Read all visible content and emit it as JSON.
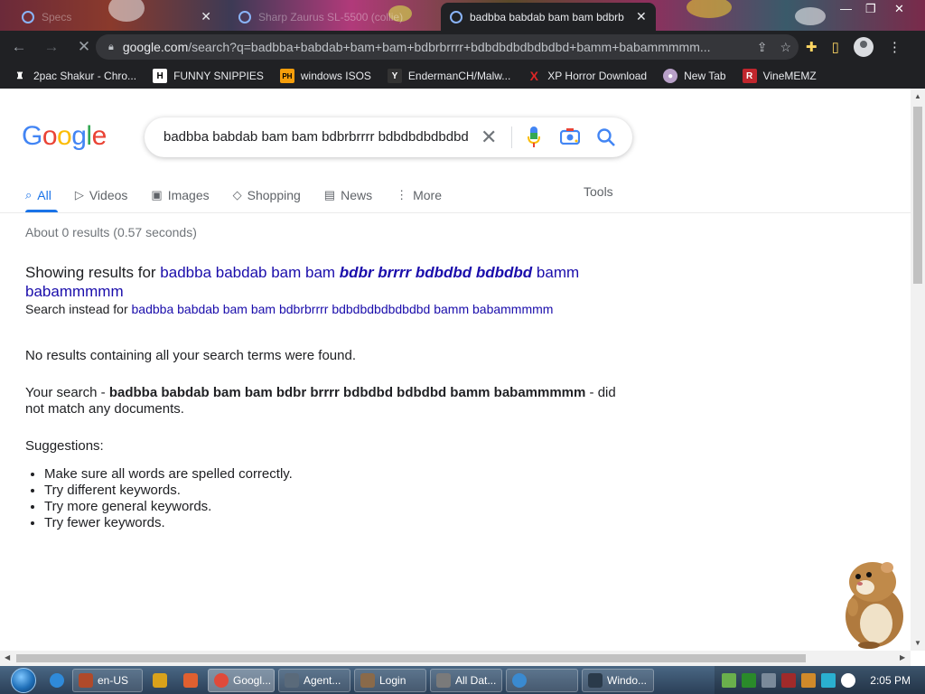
{
  "browser": {
    "tabs": [
      {
        "title": "Specs"
      },
      {
        "title": "Sharp Zaurus SL-5500 (collie)"
      },
      {
        "title": "badbba babdab bam bam bdbrb"
      }
    ],
    "url_host": "google.com",
    "url_path": "/search?q=badbba+babdab+bam+bam+bdbrbrrrr+bdbdbdbdbdbdbd+bamm+babammmmm...",
    "bookmarks": [
      {
        "label": "2pac Shakur - Chro...",
        "color": "#7a5230",
        "glyph": "♜"
      },
      {
        "label": "FUNNY SNIPPIES",
        "color": "#000000",
        "glyph": "H"
      },
      {
        "label": "windows ISOS",
        "color": "#f59e0b",
        "glyph": "PH"
      },
      {
        "label": "EndermanCH/Malw...",
        "color": "#111111",
        "glyph": "Y"
      },
      {
        "label": "XP Horror Download",
        "color": "#dc2626",
        "glyph": "X"
      },
      {
        "label": "New Tab",
        "color": "#a0a0c0",
        "glyph": "●"
      },
      {
        "label": "VineMEMZ",
        "color": "#c0262d",
        "glyph": "R"
      }
    ]
  },
  "google": {
    "logo": "Google",
    "query": "badbba babdab bam bam bdbrbrrrr bdbdbdbdbdbdbd",
    "tabs": [
      {
        "label": "All",
        "icon": "search-icon",
        "glyph": "⌕"
      },
      {
        "label": "Videos",
        "icon": "video-icon",
        "glyph": "▷"
      },
      {
        "label": "Images",
        "icon": "image-icon",
        "glyph": "▣"
      },
      {
        "label": "Shopping",
        "icon": "tag-icon",
        "glyph": "◇"
      },
      {
        "label": "News",
        "icon": "news-icon",
        "glyph": "▤"
      },
      {
        "label": "More",
        "icon": "more-icon",
        "glyph": "⋮"
      }
    ],
    "tools": "Tools",
    "stats": "About 0 results (0.57 seconds)",
    "showing_prefix": "Showing results for ",
    "showing_plain_a": "badbba babdab bam bam ",
    "showing_corrected": "bdbr brrrr bdbdbd bdbdbd",
    "showing_plain_b": " bamm babammmmm",
    "instead_prefix": "Search instead for ",
    "instead_link": "badbba babdab bam bam bdbrbrrrr bdbdbdbdbdbdbd bamm babammmmm",
    "no_results": "No results containing all your search terms were found.",
    "your_search_prefix": "Your search - ",
    "your_search_terms": "badbba babdab bam bam bdbr brrrr bdbdbd bdbdbd bamm babammmmm",
    "your_search_suffix": " - did not match any documents.",
    "suggestions_label": "Suggestions:",
    "suggestions": [
      "Make sure all words are spelled correctly.",
      "Try different keywords.",
      "Try more general keywords.",
      "Try fewer keywords."
    ]
  },
  "taskbar": {
    "buttons": [
      {
        "label": "",
        "color": "#2f8ad9"
      },
      {
        "label": "en-US",
        "color": "#b04a2a"
      },
      {
        "label": "",
        "color": "#d9a21b"
      },
      {
        "label": "",
        "color": "#e06030"
      },
      {
        "label": "Googl...",
        "color": "#e04a3a"
      },
      {
        "label": "Agent...",
        "color": "#5a6a7a"
      },
      {
        "label": "Login",
        "color": "#8a6a4a"
      },
      {
        "label": "All Dat...",
        "color": "#7a7a7a"
      },
      {
        "label": "",
        "color": "#3a8ad0"
      },
      {
        "label": "Windo...",
        "color": "#2a3a4a"
      }
    ],
    "tray_colors": [
      "#6ab04c",
      "#2a8a2a",
      "#7a8a9a",
      "#a02a2a",
      "#d08a2a",
      "#2ab0d0",
      "#ffffff"
    ],
    "clock": "2:05 PM"
  }
}
